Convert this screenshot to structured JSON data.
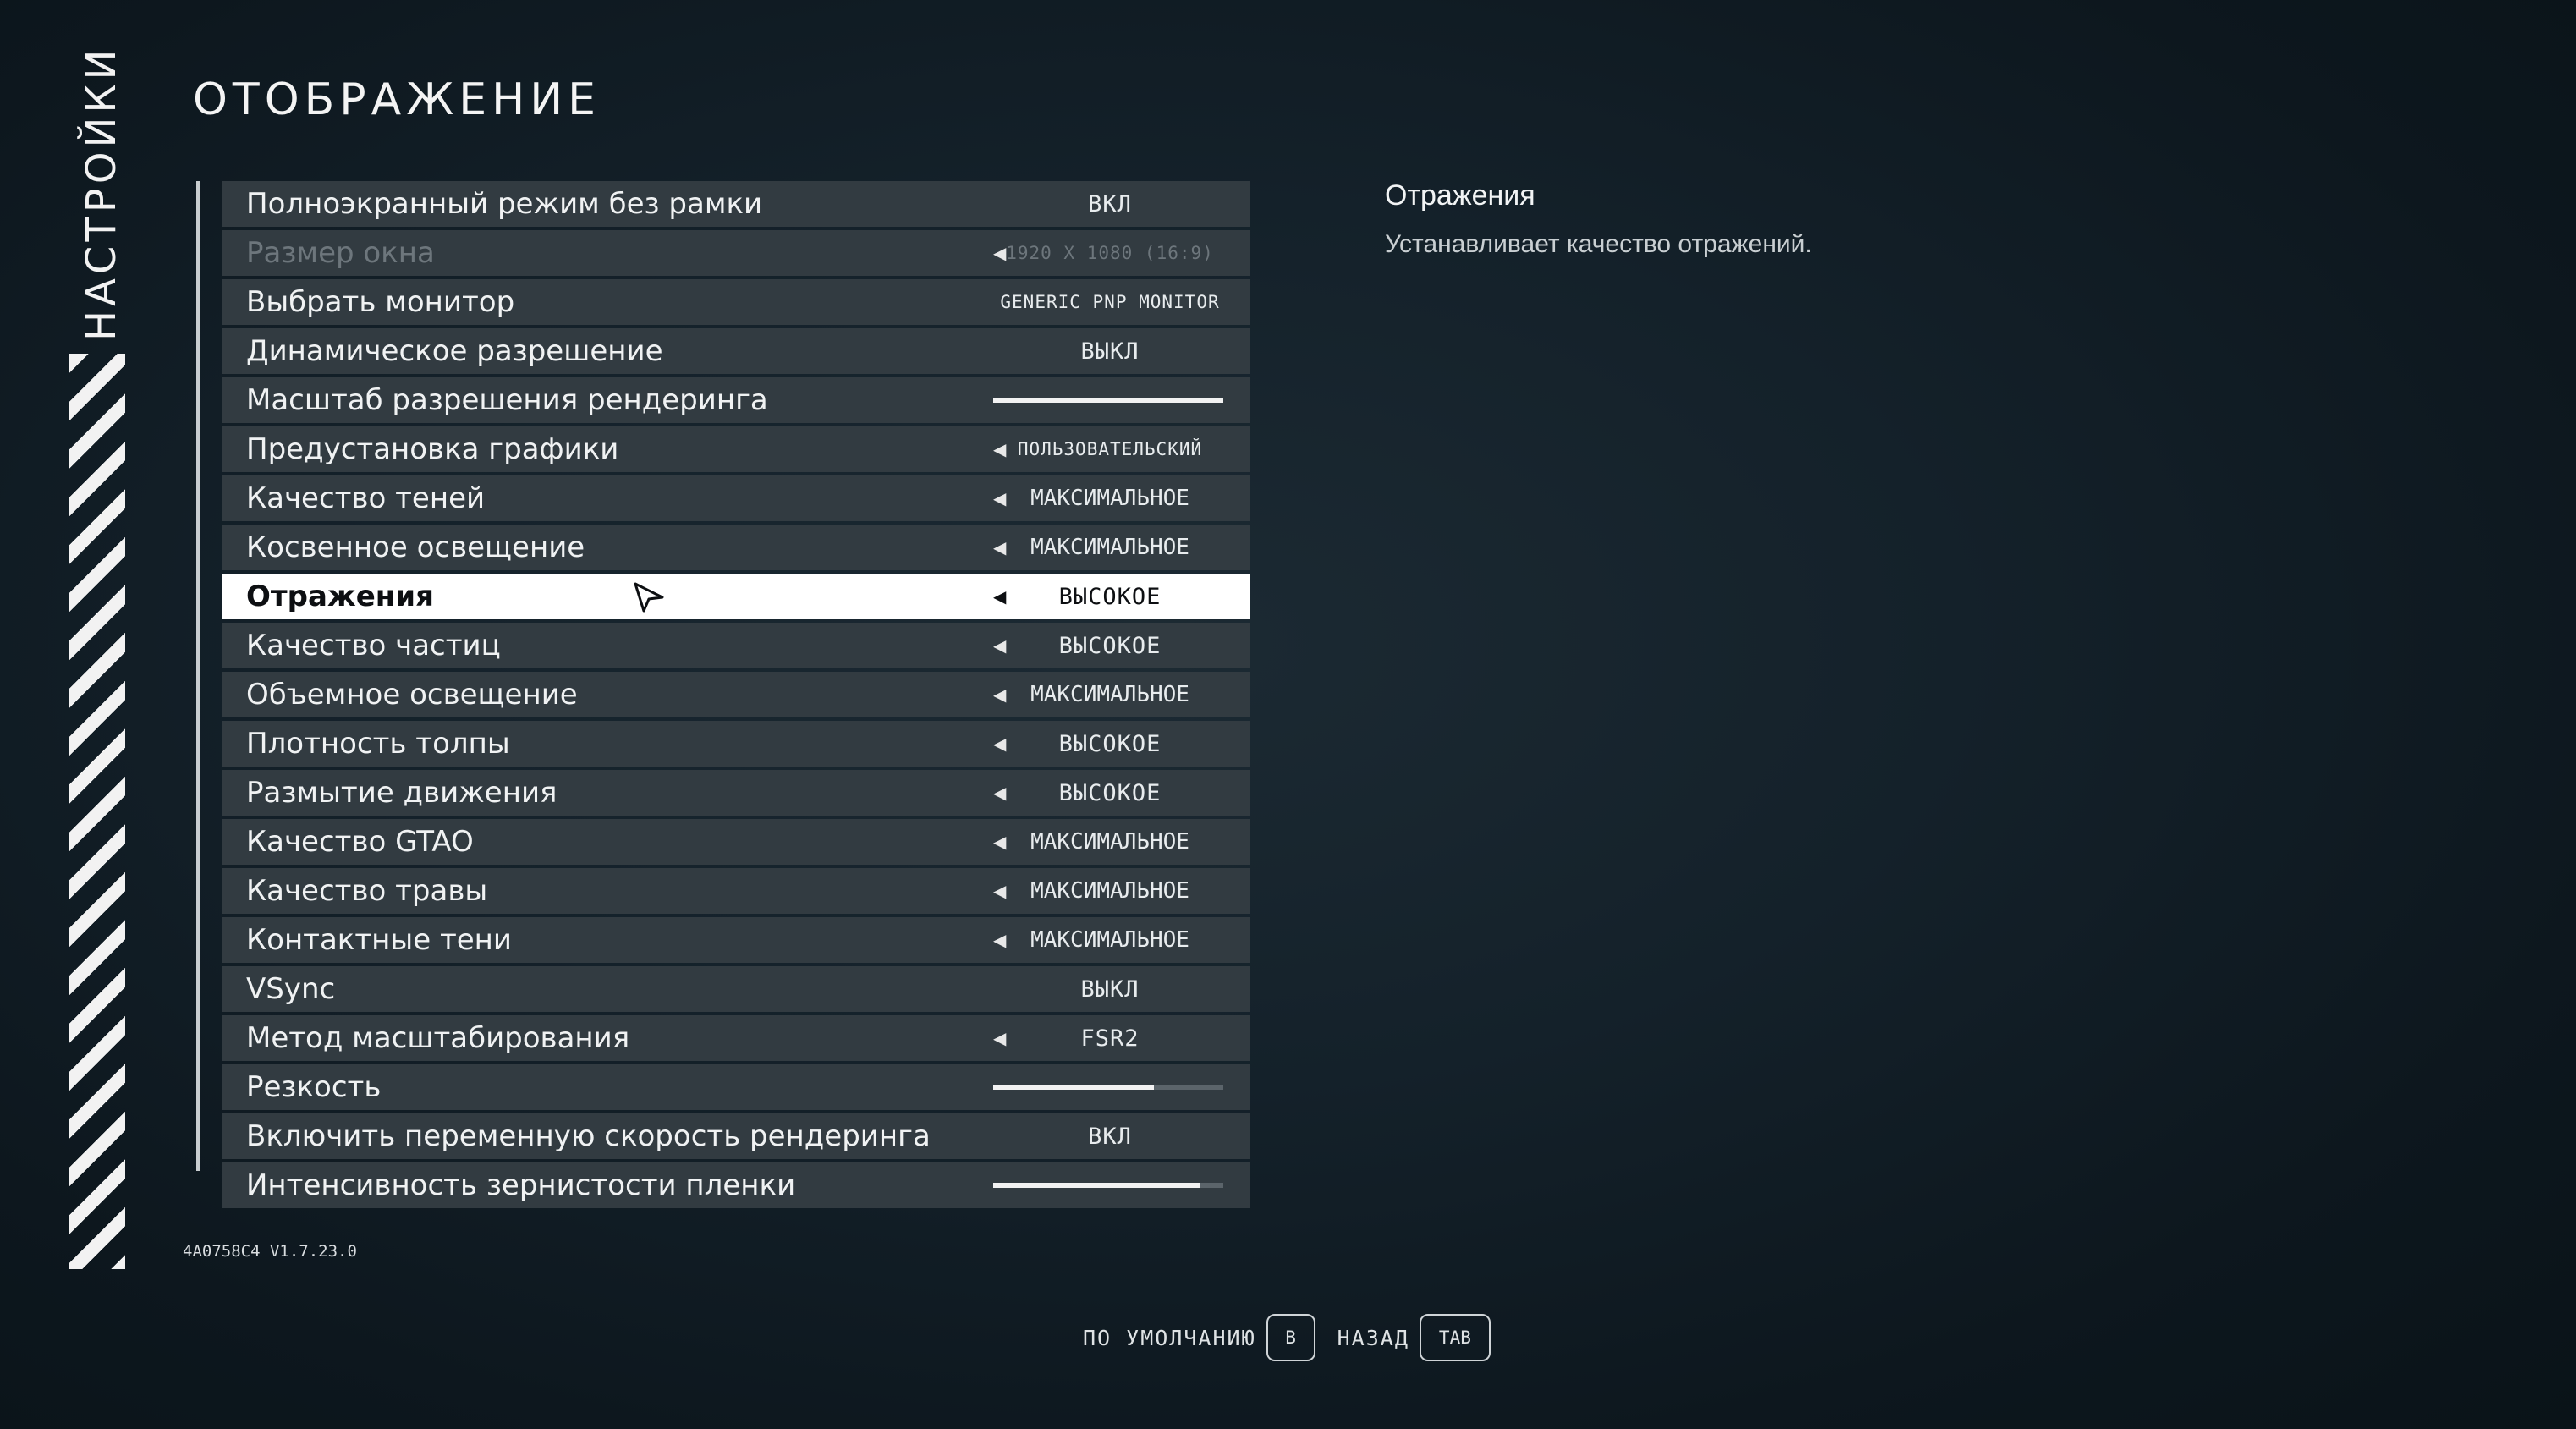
{
  "sidebar": {
    "title": "НАСТРОЙКИ"
  },
  "page": {
    "title": "ОТОБРАЖЕНИЕ"
  },
  "settings": [
    {
      "label": "Полноэкранный режим без рамки",
      "value": "ВКЛ",
      "arrow": false
    },
    {
      "label": "Размер окна",
      "value": "1920 X 1080 (16:9)",
      "arrow": true,
      "disabled": true
    },
    {
      "label": "Выбрать монитор",
      "value": "GENERIC PNP MONITOR",
      "arrow": false
    },
    {
      "label": "Динамическое разрешение",
      "value": "ВЫКЛ",
      "arrow": false
    },
    {
      "label": "Масштаб разрешения рендеринга",
      "slider": 1.0
    },
    {
      "label": "Предустановка графики",
      "value": "ПОЛЬЗОВАТЕЛЬСКИЙ",
      "arrow": true
    },
    {
      "label": "Качество теней",
      "value": "МАКСИМАЛЬНОЕ",
      "arrow": true
    },
    {
      "label": "Косвенное освещение",
      "value": "МАКСИМАЛЬНОЕ",
      "arrow": true
    },
    {
      "label": "Отражения",
      "value": "ВЫСОКОЕ",
      "arrow": true,
      "selected": true
    },
    {
      "label": "Качество частиц",
      "value": "ВЫСОКОЕ",
      "arrow": true
    },
    {
      "label": "Объемное освещение",
      "value": "МАКСИМАЛЬНОЕ",
      "arrow": true
    },
    {
      "label": "Плотность толпы",
      "value": "ВЫСОКОЕ",
      "arrow": true
    },
    {
      "label": "Размытие движения",
      "value": "ВЫСОКОЕ",
      "arrow": true
    },
    {
      "label": "Качество GTAO",
      "value": "МАКСИМАЛЬНОЕ",
      "arrow": true
    },
    {
      "label": "Качество травы",
      "value": "МАКСИМАЛЬНОЕ",
      "arrow": true
    },
    {
      "label": "Контактные тени",
      "value": "МАКСИМАЛЬНОЕ",
      "arrow": true
    },
    {
      "label": "VSync",
      "value": "ВЫКЛ",
      "arrow": false
    },
    {
      "label": "Метод масштабирования",
      "value": "FSR2",
      "arrow": true
    },
    {
      "label": "Резкость",
      "slider": 0.7
    },
    {
      "label": "Включить переменную скорость рендеринга",
      "value": "ВКЛ",
      "arrow": false
    },
    {
      "label": "Интенсивность зернистости пленки",
      "slider": 0.9
    }
  ],
  "description": {
    "title": "Отражения",
    "text": "Устанавливает качество отражений."
  },
  "version": "4A0758C4 V1.7.23.0",
  "footer": {
    "default_label": "ПО УМОЛЧАНИЮ",
    "default_key": "B",
    "back_label": "НАЗАД",
    "back_key": "TAB"
  }
}
